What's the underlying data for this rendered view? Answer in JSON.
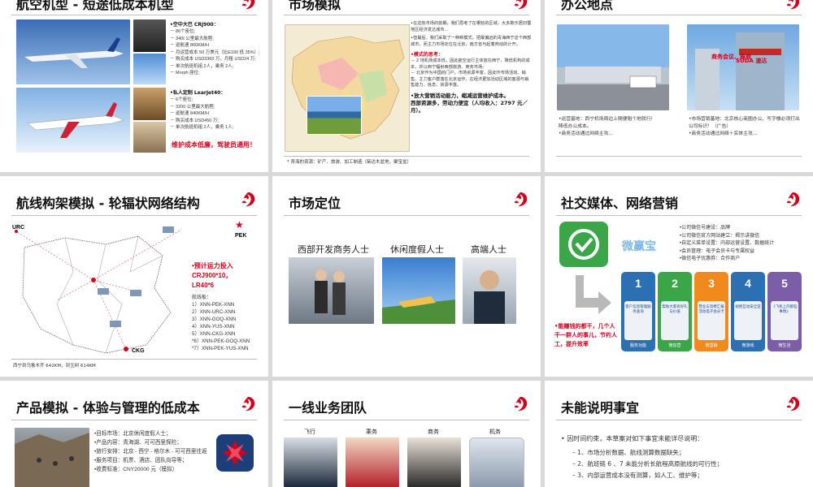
{
  "slides": [
    {
      "title": "航空机型 - 短途低成本机型",
      "crj_head": "•空中大巴 CRJ900：",
      "crj_specs": [
        "－ 86个座位;",
        "－ 340t 公里最大航程;",
        "－ 巡航速 860KM/H",
        "－ 月运营成本 50 万美元（比E190 低 35%）;",
        "－ 购买成本 USD3360 万，月租 USD24 万;",
        "－ 单次航班机组 2人，乘务 2人;",
        "－ Morph 座位;"
      ],
      "lear_head": "•私人定制 LearJet40：",
      "lear_specs": [
        "－ 6个座位;",
        "－ 3200 公里最大航程;",
        "－ 巡航速 840KM/H",
        "－ 购买成本 USD450 万;",
        "－ 单次航班机组 2人，乘务 1人;"
      ],
      "note": "维护成本低廉，驾驶员通用！"
    },
    {
      "title": "市场模拟",
      "para1": "•在这些市场的前期，我们思考了在哪些的区域，大多数乐居旧蜀地区经济发达城市…",
      "para2": "•但最后，我们采取了一种新模式，把最偏远的青海西宁这个西部城市，而主力市场定位在北京，南方省与起着商动的计开。",
      "think_head": "•模式的思考：",
      "think_lines": [
        "－ 2 地机场成本低，因此航空运行主体放在西宁，降低机构的成本，并以西宁辐射西部旅游、商务市场;",
        "－ 北京作为中国的门户，市场资源丰富，因此作市场活动、销售、主力客户群落在北京运作，在经济更加活动区域的客源与销售能力，信息、资源丰富。"
      ],
      "conclusion": "•放大营销活动能力，缩减运营维护成本。",
      "conclusion2": "西部资源多，劳动力便宜（人均收入：2797 元／月）。",
      "footnote": "* 青海的资源：矿产、旅游、加工制造（柴达木盆地，聚宝盆）"
    },
    {
      "title": "办公地点",
      "banner": "商务会议、展商",
      "brand": "SUDA 速达",
      "left_lines": [
        "•运营基地：西宁机场周边上随便租个地就行!",
        "降低办公成本。",
        "•商务活动通过网络主攻…"
      ],
      "right_lines": [
        "•市场营销基地：北京核心商圈办公、写字楼必须打出公司标识！（广告）",
        "•商务活动通过网络＋实体主攻…"
      ]
    },
    {
      "title": "航线构架模拟 - 轮辐状网络结构",
      "labels": {
        "urc": "URC",
        "pek": "PEK",
        "ckg": "CKG"
      },
      "fleet_line1": "•预计运力投入",
      "fleet_line2": "CRJ900*10，",
      "fleet_line3": "LR40*6",
      "routes_head": "航线板：",
      "routes": [
        "1）XNN-PEK-XNN",
        "2）XNN-URC-XNN",
        "3）XNN-GOQ-XNN",
        "4）XNN-YUS-XNN",
        "5）XNN-CKG-XNN",
        "*6）XNN-PEK-GOQ-XNN",
        "*7）XNN-PEK-YUS-XNN"
      ],
      "footer": "西宁到乌鲁木齐 642KM，到玉树 614KM"
    },
    {
      "title": "市场定位",
      "segments": [
        "西部开发商务人士",
        "休闲度假人士",
        "高端人士"
      ]
    },
    {
      "title": "社交媒体、网络营销",
      "brand": "微赢宝",
      "bullets": [
        "•公司微信号建设：品牌",
        "•公司微信官方网站建立：揭示讲微信",
        "•自定义菜单设置：内部运营设置、数据统计",
        "•会员管理：电子会员卡与专属权益",
        "•微信电子优惠券：合作商户"
      ],
      "puzzle_nums": [
        "1",
        "2",
        "3",
        "4",
        "5"
      ],
      "puzzle_inner": [
        "客户信息管理服务查询",
        "帮助大家有好礼与价值",
        "营业与消费汇报活动电子会员卡",
        "视频互动安全室",
        "《飞机上的那些事情》"
      ],
      "puzzle_labels": [
        "服务功能",
        "微信营",
        "微营销",
        "微游戏",
        "微生活"
      ],
      "slogan": "•能赚钱的都干，几个人干一群人的事儿，节约人工，提升效率"
    },
    {
      "title": "产品模拟 - 体验与管理的低成本",
      "lines": [
        "•目标市场：北京休闲度假人士；",
        "•产品内容：青海湖、可可西里探险；",
        "•旅行安排：北京 - 西宁 - 格尔木 - 可可西里往返",
        "•服务项目：机票、酒店、团队向导等；",
        "•收费标准：CNY20000 元（模拟）"
      ]
    },
    {
      "title": "一线业务团队",
      "teams": [
        "飞行",
        "乘务",
        "商务",
        "机务"
      ]
    },
    {
      "title": "未能说明事宜",
      "intro": "•  因时间约束，本草案对如下事宜未能详尽说明：",
      "items": [
        "–  1、市场分析数据、航线测算数据缺失；",
        "–  2、航班链 6 、7 未能分析长航程高原航线的可行性；",
        "–  3、内部运营成本没有测算，如人工、维护等；"
      ]
    }
  ],
  "colors": {
    "accent": "#d0021b",
    "puzzle": [
      "#2c6fb3",
      "#3aa648",
      "#f08a1c",
      "#2c6fb3",
      "#7b5ea7"
    ]
  },
  "icons": [
    "phoenix-logo-icon",
    "wechat-icon",
    "star-icon"
  ]
}
